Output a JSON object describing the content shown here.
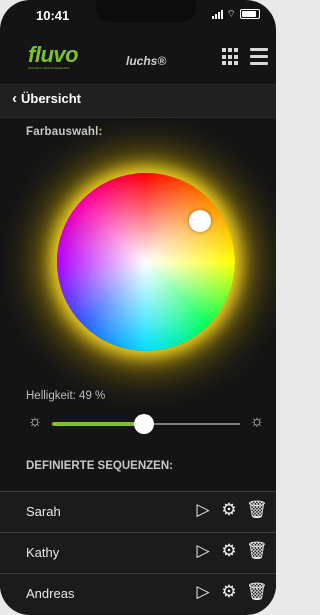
{
  "status_bar": {
    "time": "10:41"
  },
  "header": {
    "logo": "fluvo",
    "logo_tagline": "innovative schwimmbadtechnik",
    "product": "luchs®"
  },
  "nav": {
    "back_label": "Übersicht"
  },
  "color_section": {
    "title": "Farbauswahl:"
  },
  "brightness": {
    "label": "Helligkeit: 49 %",
    "value_percent": 49
  },
  "sequences": {
    "title": "DEFINIERTE SEQUENZEN:",
    "items": [
      {
        "name": "Sarah"
      },
      {
        "name": "Kathy"
      },
      {
        "name": "Andreas"
      }
    ]
  },
  "icons": {
    "play": "play-icon",
    "settings": "gear-icon",
    "delete": "trash-icon"
  },
  "colors": {
    "accent": "#7cc22a",
    "background": "#141414"
  }
}
